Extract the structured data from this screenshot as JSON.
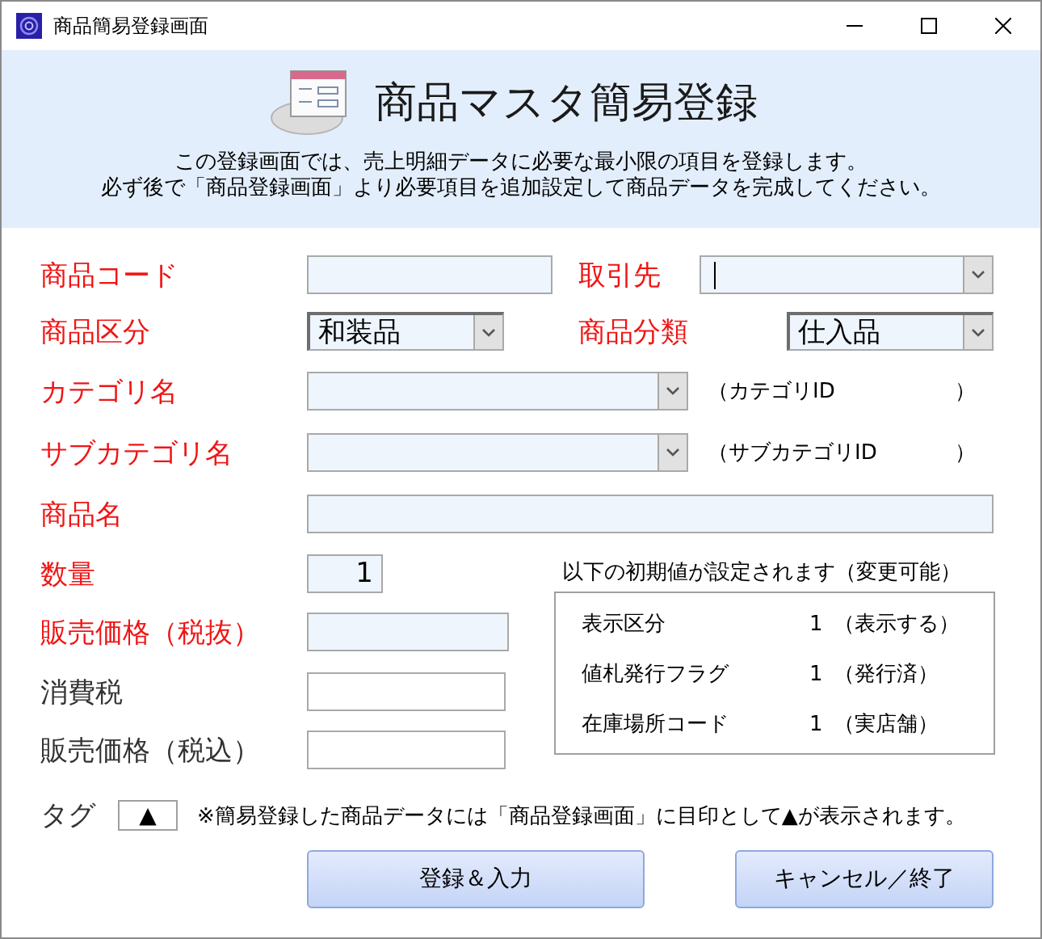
{
  "window": {
    "title": "商品簡易登録画面"
  },
  "header": {
    "title": "商品マスタ簡易登録",
    "lines": [
      "この登録画面では、売上明細データに必要な最小限の項目を登録します。",
      "必ず後で「商品登録画面」より必要項目を追加設定して商品データを完成してください。"
    ]
  },
  "fields": [
    {
      "label": "商品コード",
      "required": true,
      "kind": "text"
    },
    {
      "label": "取引先",
      "required": true,
      "kind": "combo",
      "focused": true
    },
    {
      "label": "商品区分",
      "required": true,
      "kind": "combo",
      "value": "和装品"
    },
    {
      "label": "商品分類",
      "required": true,
      "kind": "combo",
      "value": "仕入品"
    },
    {
      "label": "カテゴリ名",
      "required": true,
      "kind": "combo",
      "suffix": "（カテゴリID",
      "suffix_end": "）"
    },
    {
      "label": "サブカテゴリ名",
      "required": true,
      "kind": "combo",
      "suffix": "（サブカテゴリID",
      "suffix_end": "）"
    },
    {
      "label": "商品名",
      "required": true,
      "kind": "text"
    },
    {
      "label": "数量",
      "required": true,
      "kind": "text",
      "value": "1"
    },
    {
      "label": "販売価格（税抜）",
      "required": true,
      "kind": "text"
    },
    {
      "label": "消費税",
      "required": false,
      "kind": "text"
    },
    {
      "label": "販売価格（税込）",
      "required": false,
      "kind": "text"
    }
  ],
  "defaults": {
    "note": "以下の初期値が設定されます（変更可能）",
    "items": [
      {
        "label": "表示区分",
        "value": "1",
        "description": "（表示する）"
      },
      {
        "label": "値札発行フラグ",
        "value": "1",
        "description": "（発行済）"
      },
      {
        "label": "在庫場所コード",
        "value": "1",
        "description": "（実店舗）"
      }
    ]
  },
  "tag": {
    "label": "タグ",
    "symbol": "▲",
    "note": "※簡易登録した商品データには「商品登録画面」に目印として▲が表示されます。"
  },
  "buttons": [
    "登録＆入力",
    "キャンセル／終了"
  ]
}
